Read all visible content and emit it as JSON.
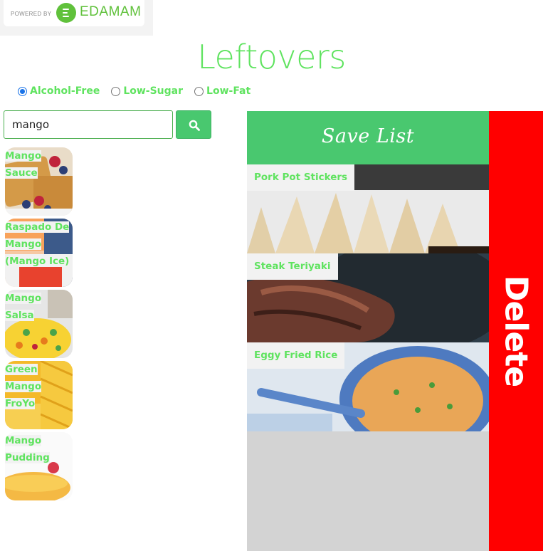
{
  "powered": {
    "label": "POWERED BY",
    "brand": "EDAMAM",
    "brand_color": "#60c13b"
  },
  "title": "Leftovers",
  "filters": [
    {
      "label": "Alcohol-Free",
      "checked": true
    },
    {
      "label": "Low-Sugar",
      "checked": false
    },
    {
      "label": "Low-Fat",
      "checked": false
    }
  ],
  "search": {
    "value": "mango",
    "button_icon": "search-icon"
  },
  "results": [
    {
      "name": " Mango\nSauce",
      "image": "waffles-with-berries"
    },
    {
      "name": " Raspado De\nMango\n(Mango Ice)",
      "image": "shaved-ice-cup"
    },
    {
      "name": " Mango\nSalsa",
      "image": "mango-salsa-bowl"
    },
    {
      "name": " Green\nMango\nFroYo",
      "image": "sliced-mango"
    },
    {
      "name": " Mango\nPudding",
      "image": "mango-pudding"
    }
  ],
  "saved": {
    "header": "Save List",
    "items": [
      {
        "name": "Pork Pot Stickers",
        "image": "pot-stickers"
      },
      {
        "name": "Steak Teriyaki",
        "image": "steak-teriyaki"
      },
      {
        "name": "Eggy Fried Rice",
        "image": "fried-rice-bowl"
      }
    ]
  },
  "delete_label": "Delete",
  "colors": {
    "accent": "#5fe35f",
    "header_green": "#49c86f",
    "delete_red": "#ff0000",
    "panel_gray": "#d3d3d3"
  }
}
